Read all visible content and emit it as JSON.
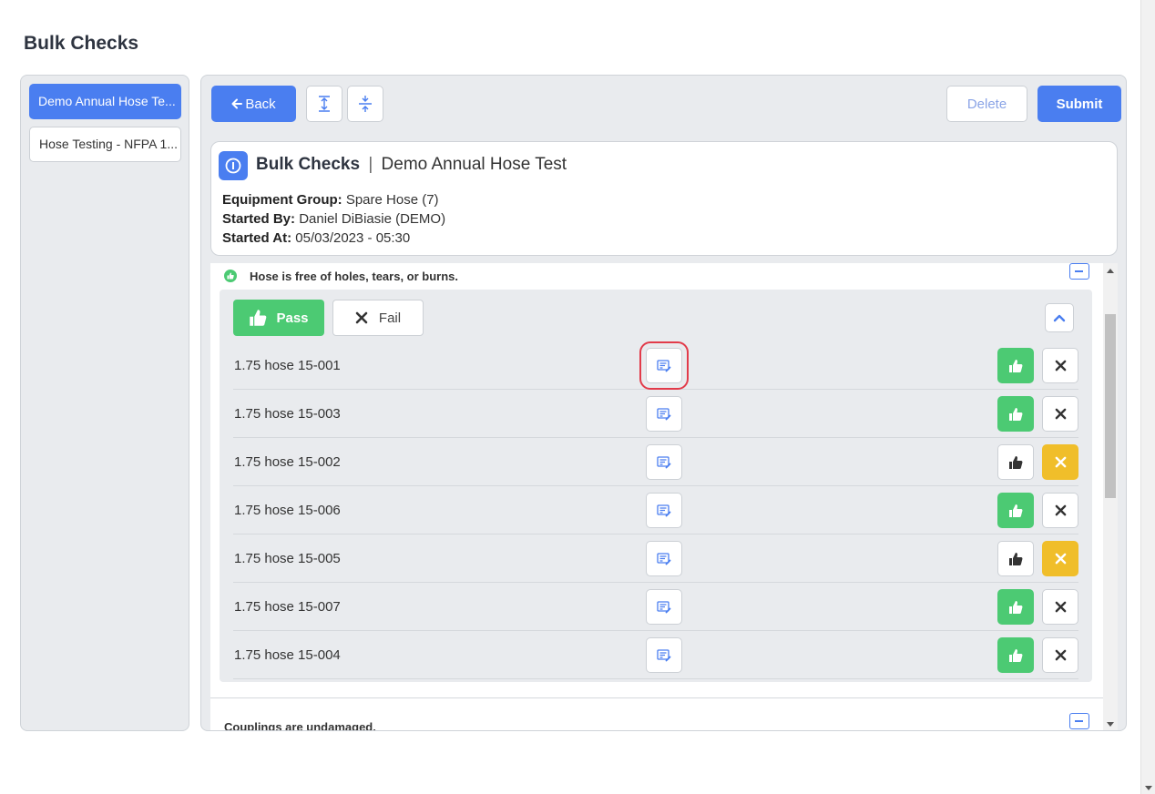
{
  "page": {
    "title": "Bulk Checks"
  },
  "sidebar": {
    "items": [
      {
        "label": "Demo Annual Hose Te...",
        "active": true
      },
      {
        "label": "Hose Testing - NFPA 1...",
        "active": false
      }
    ]
  },
  "toolbar": {
    "back_label": "Back",
    "delete_label": "Delete",
    "submit_label": "Submit"
  },
  "info": {
    "title": "Bulk Checks",
    "separator": "|",
    "subtitle": "Demo Annual Hose Test",
    "equipment_group_label": "Equipment Group:",
    "equipment_group_value": "Spare Hose (7)",
    "started_by_label": "Started By:",
    "started_by_value": "Daniel DiBiasie (DEMO)",
    "started_at_label": "Started At:",
    "started_at_value": "05/03/2023 - 05:30"
  },
  "checks": [
    {
      "title": "Hose is free of holes, tears, or burns.",
      "pass_all_label": "Pass",
      "fail_all_label": "Fail",
      "items": [
        {
          "name": "1.75 hose 15-001",
          "status": "pass"
        },
        {
          "name": "1.75 hose 15-003",
          "status": "pass"
        },
        {
          "name": "1.75 hose 15-002",
          "status": "fail"
        },
        {
          "name": "1.75 hose 15-006",
          "status": "pass"
        },
        {
          "name": "1.75 hose 15-005",
          "status": "fail"
        },
        {
          "name": "1.75 hose 15-007",
          "status": "pass"
        },
        {
          "name": "1.75 hose 15-004",
          "status": "pass"
        }
      ]
    },
    {
      "title": "Couplings are undamaged."
    }
  ],
  "colors": {
    "primary": "#4a7ef0",
    "pass": "#4cca73",
    "fail": "#f0be2a",
    "highlight": "#e23b4a"
  },
  "icons": {
    "back": "arrow-left-icon",
    "expand": "expand-vertical-icon",
    "collapse": "collapse-vertical-icon",
    "info": "info-icon",
    "note": "note-edit-icon",
    "pass": "thumbs-up-icon",
    "fail": "x-icon"
  }
}
